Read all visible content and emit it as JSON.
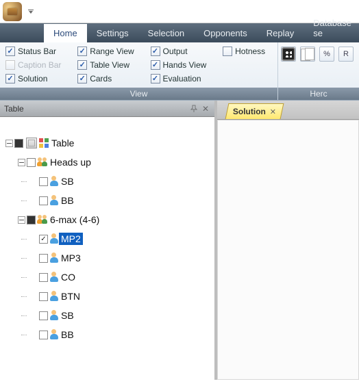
{
  "titlebar": {
    "app_name": "App"
  },
  "tabs": [
    {
      "label": "Home",
      "active": true
    },
    {
      "label": "Settings",
      "active": false
    },
    {
      "label": "Selection",
      "active": false
    },
    {
      "label": "Opponents",
      "active": false
    },
    {
      "label": "Replay",
      "active": false
    },
    {
      "label": "Database se",
      "active": false
    }
  ],
  "ribbon": {
    "group_label": "View",
    "hero_label": "Herc",
    "items": [
      {
        "label": "Status Bar",
        "checked": true,
        "col": 0,
        "row": 0
      },
      {
        "label": "Caption Bar",
        "checked": false,
        "col": 0,
        "row": 1,
        "disabled": true
      },
      {
        "label": "Solution",
        "checked": true,
        "col": 0,
        "row": 2
      },
      {
        "label": "Range View",
        "checked": true,
        "col": 1,
        "row": 0
      },
      {
        "label": "Table View",
        "checked": true,
        "col": 1,
        "row": 1
      },
      {
        "label": "Cards",
        "checked": true,
        "col": 1,
        "row": 2
      },
      {
        "label": "Output",
        "checked": true,
        "col": 2,
        "row": 0
      },
      {
        "label": "Hands View",
        "checked": true,
        "col": 2,
        "row": 1
      },
      {
        "label": "Evaluation",
        "checked": true,
        "col": 2,
        "row": 2
      },
      {
        "label": "Hotness",
        "checked": false,
        "col": 3,
        "row": 0
      }
    ],
    "tools": [
      {
        "name": "dice-icon"
      },
      {
        "name": "cards-icon"
      },
      {
        "name": "percent-button",
        "text": "%"
      },
      {
        "name": "r-button",
        "text": "R"
      }
    ]
  },
  "left_panel": {
    "title": "Table",
    "tree": {
      "root": {
        "label": "Table"
      },
      "groups": [
        {
          "label": "Heads up",
          "checked": false,
          "children": [
            {
              "label": "SB",
              "checked": false
            },
            {
              "label": "BB",
              "checked": false
            }
          ]
        },
        {
          "label": "6-max (4-6)",
          "checked": "filled",
          "children": [
            {
              "label": "MP2",
              "checked": true,
              "selected": true
            },
            {
              "label": "MP3",
              "checked": false
            },
            {
              "label": "CO",
              "checked": false
            },
            {
              "label": "BTN",
              "checked": false
            },
            {
              "label": "SB",
              "checked": false
            },
            {
              "label": "BB",
              "checked": false
            }
          ]
        }
      ]
    }
  },
  "right_panel": {
    "tab_label": "Solution"
  }
}
